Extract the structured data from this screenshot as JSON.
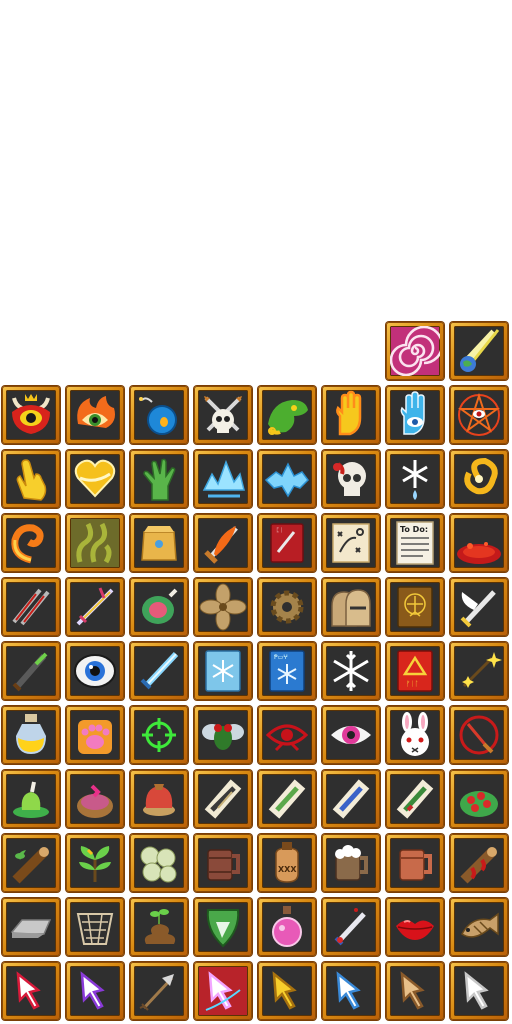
{
  "sheet": {
    "columns": 8,
    "rows_total": 11,
    "slots": [
      {
        "row": 0,
        "col": 6,
        "icon": "pink-spiral-icon"
      },
      {
        "row": 0,
        "col": 7,
        "icon": "comet-planet-icon"
      },
      {
        "row": 1,
        "col": 0,
        "icon": "red-horned-demon-eye-icon"
      },
      {
        "row": 1,
        "col": 1,
        "icon": "flaming-eye-icon"
      },
      {
        "row": 1,
        "col": 2,
        "icon": "bomb-orb-icon"
      },
      {
        "row": 1,
        "col": 3,
        "icon": "skull-crossed-swords-icon"
      },
      {
        "row": 1,
        "col": 4,
        "icon": "green-dragon-head-icon"
      },
      {
        "row": 1,
        "col": 5,
        "icon": "glowing-yellow-hand-icon"
      },
      {
        "row": 1,
        "col": 6,
        "icon": "blue-hand-eye-icon"
      },
      {
        "row": 1,
        "col": 7,
        "icon": "pentagram-eye-icon"
      },
      {
        "row": 2,
        "col": 0,
        "icon": "pointing-hand-gold-icon"
      },
      {
        "row": 2,
        "col": 1,
        "icon": "golden-heart-icon"
      },
      {
        "row": 2,
        "col": 2,
        "icon": "zombie-hand-icon"
      },
      {
        "row": 2,
        "col": 3,
        "icon": "ice-crystals-icon"
      },
      {
        "row": 2,
        "col": 4,
        "icon": "ice-shard-icon"
      },
      {
        "row": 2,
        "col": 5,
        "icon": "cracked-skull-icon"
      },
      {
        "row": 2,
        "col": 6,
        "icon": "snowflake-drop-icon"
      },
      {
        "row": 2,
        "col": 7,
        "icon": "golden-vortex-icon"
      },
      {
        "row": 3,
        "col": 0,
        "icon": "fire-swirl-icon"
      },
      {
        "row": 3,
        "col": 1,
        "icon": "green-stench-icon"
      },
      {
        "row": 3,
        "col": 2,
        "icon": "paper-bag-icon"
      },
      {
        "row": 3,
        "col": 3,
        "icon": "flaming-sword-icon"
      },
      {
        "row": 3,
        "col": 4,
        "icon": "red-spellbook-icon"
      },
      {
        "row": 3,
        "col": 5,
        "icon": "tactics-scroll-icon"
      },
      {
        "row": 3,
        "col": 6,
        "icon": "todo-list-icon"
      },
      {
        "row": 3,
        "col": 7,
        "icon": "lava-pool-icon"
      },
      {
        "row": 4,
        "col": 0,
        "icon": "twin-red-swords-icon"
      },
      {
        "row": 4,
        "col": 1,
        "icon": "golden-spear-sword-icon"
      },
      {
        "row": 4,
        "col": 2,
        "icon": "ham-icon"
      },
      {
        "row": 4,
        "col": 3,
        "icon": "fan-blades-icon"
      },
      {
        "row": 4,
        "col": 4,
        "icon": "gear-icon"
      },
      {
        "row": 4,
        "col": 5,
        "icon": "helmets-icon"
      },
      {
        "row": 4,
        "col": 6,
        "icon": "vitruvian-book-icon"
      },
      {
        "row": 4,
        "col": 7,
        "icon": "winged-sword-icon"
      },
      {
        "row": 5,
        "col": 0,
        "icon": "green-dagger-icon"
      },
      {
        "row": 5,
        "col": 1,
        "icon": "blue-eye-icon"
      },
      {
        "row": 5,
        "col": 2,
        "icon": "ice-sword-icon"
      },
      {
        "row": 5,
        "col": 3,
        "icon": "ice-spellbook-icon"
      },
      {
        "row": 5,
        "col": 4,
        "icon": "blue-spellbook-icon"
      },
      {
        "row": 5,
        "col": 5,
        "icon": "snowflake-icon"
      },
      {
        "row": 5,
        "col": 6,
        "icon": "red-rune-book-icon"
      },
      {
        "row": 5,
        "col": 7,
        "icon": "sparking-wand-icon"
      },
      {
        "row": 6,
        "col": 0,
        "icon": "potion-bottle-icon"
      },
      {
        "row": 6,
        "col": 1,
        "icon": "paw-print-icon"
      },
      {
        "row": 6,
        "col": 2,
        "icon": "crosshair-icon"
      },
      {
        "row": 6,
        "col": 3,
        "icon": "fly-icon"
      },
      {
        "row": 6,
        "col": 4,
        "icon": "red-eye-sigil-icon"
      },
      {
        "row": 6,
        "col": 5,
        "icon": "pink-eye-icon"
      },
      {
        "row": 6,
        "col": 6,
        "icon": "bunny-head-icon"
      },
      {
        "row": 6,
        "col": 7,
        "icon": "red-swipe-icon"
      },
      {
        "row": 7,
        "col": 0,
        "icon": "green-meat-dish-icon"
      },
      {
        "row": 7,
        "col": 1,
        "icon": "berry-pie-icon"
      },
      {
        "row": 7,
        "col": 2,
        "icon": "stew-jug-icon"
      },
      {
        "row": 7,
        "col": 3,
        "icon": "scroll-wrap-icon"
      },
      {
        "row": 7,
        "col": 4,
        "icon": "green-scroll-icon"
      },
      {
        "row": 7,
        "col": 5,
        "icon": "blue-scroll-icon"
      },
      {
        "row": 7,
        "col": 6,
        "icon": "green-scroll-red-icon"
      },
      {
        "row": 7,
        "col": 7,
        "icon": "berry-salad-icon"
      },
      {
        "row": 8,
        "col": 0,
        "icon": "branch-log-icon"
      },
      {
        "row": 8,
        "col": 1,
        "icon": "leafy-herb-icon"
      },
      {
        "row": 8,
        "col": 2,
        "icon": "dumplings-icon"
      },
      {
        "row": 8,
        "col": 3,
        "icon": "wooden-mug-icon"
      },
      {
        "row": 8,
        "col": 4,
        "icon": "xxx-jug-icon"
      },
      {
        "row": 8,
        "col": 5,
        "icon": "frothy-mug-icon"
      },
      {
        "row": 8,
        "col": 6,
        "icon": "copper-mug-icon"
      },
      {
        "row": 8,
        "col": 7,
        "icon": "bloody-log-icon"
      },
      {
        "row": 9,
        "col": 0,
        "icon": "stone-slab-icon"
      },
      {
        "row": 9,
        "col": 1,
        "icon": "net-basket-icon"
      },
      {
        "row": 9,
        "col": 2,
        "icon": "dung-sprout-icon"
      },
      {
        "row": 9,
        "col": 3,
        "icon": "green-shield-icon"
      },
      {
        "row": 9,
        "col": 4,
        "icon": "pink-potion-icon"
      },
      {
        "row": 9,
        "col": 5,
        "icon": "jeweled-dagger-icon"
      },
      {
        "row": 9,
        "col": 6,
        "icon": "red-lips-icon"
      },
      {
        "row": 9,
        "col": 7,
        "icon": "fish-icon"
      },
      {
        "row": 10,
        "col": 0,
        "icon": "red-glove-cursor-icon"
      },
      {
        "row": 10,
        "col": 1,
        "icon": "purple-glove-cursor-icon"
      },
      {
        "row": 10,
        "col": 2,
        "icon": "arrow-spear-icon"
      },
      {
        "row": 10,
        "col": 3,
        "icon": "rainbow-glove-cursor-icon"
      },
      {
        "row": 10,
        "col": 4,
        "icon": "gold-glove-cursor-icon"
      },
      {
        "row": 10,
        "col": 5,
        "icon": "blue-glove-cursor-icon"
      },
      {
        "row": 10,
        "col": 6,
        "icon": "tan-glove-cursor-icon"
      },
      {
        "row": 10,
        "col": 7,
        "icon": "white-glove-cursor-icon"
      }
    ],
    "texts": {
      "rune_book_glyphs": "ᚠᛁᛚ",
      "todo_title": "To Do:",
      "jug_label": "XXX",
      "spellbook_glyphs": "Ᵽ▭ⵖ"
    },
    "colors": {
      "frame_gold": "#f2b83a",
      "frame_dark": "#b85f08",
      "slot_bg": "#2f2f2f"
    }
  }
}
